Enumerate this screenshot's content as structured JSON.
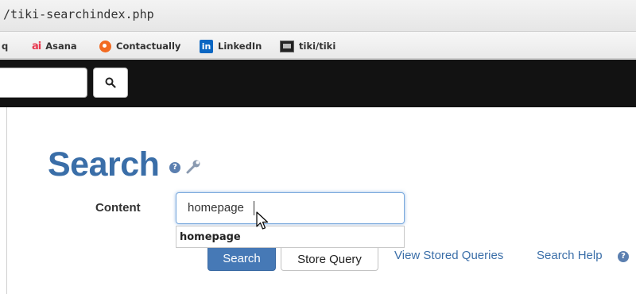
{
  "browser": {
    "url": "/tiki-searchindex.php",
    "bookmarks": [
      {
        "label": "q",
        "icon": ""
      },
      {
        "label": "Asana",
        "icon": "asana-icon"
      },
      {
        "label": "Contactually",
        "icon": "contactually-icon"
      },
      {
        "label": "LinkedIn",
        "icon": "linkedin-icon"
      },
      {
        "label": "tiki/tiki",
        "icon": "tiki-icon"
      }
    ]
  },
  "header": {
    "search_button_icon": "search-icon",
    "background": "#121212"
  },
  "page": {
    "title": "Search",
    "title_color": "#3a6ea8",
    "help_glyph": "?",
    "content_label": "Content",
    "content_value": "homepage",
    "autocomplete": [
      "homepage"
    ],
    "search_button": "Search",
    "store_query_button": "Store Query",
    "view_stored_link": "View Stored Queries",
    "search_help_link": "Search Help",
    "accent": "#4679b6"
  }
}
